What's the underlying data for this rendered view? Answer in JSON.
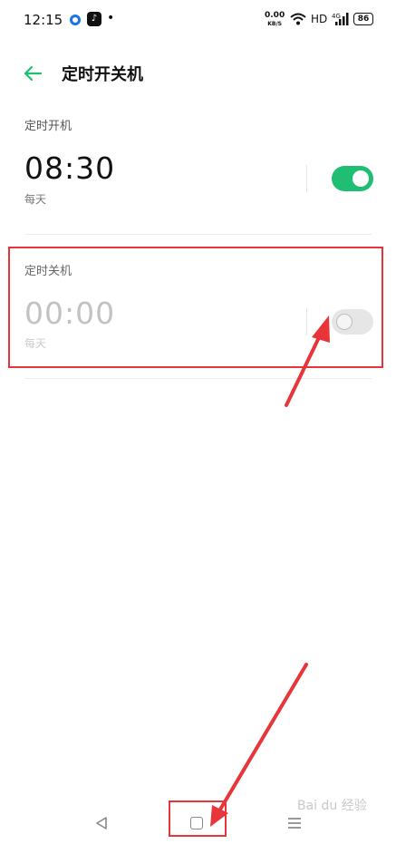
{
  "status_bar": {
    "time": "12:15",
    "speed_value": "0.00",
    "speed_unit": "KB/S",
    "network": "HD",
    "signal": "4G",
    "battery": "86"
  },
  "header": {
    "title": "定时开关机"
  },
  "power_on": {
    "section_label": "定时开机",
    "time": "08:30",
    "repeat": "每天",
    "enabled": true
  },
  "power_off": {
    "section_label": "定时关机",
    "time": "00:00",
    "repeat": "每天",
    "enabled": false
  },
  "watermark": "Bai du 经验",
  "colors": {
    "accent": "#1fbe72",
    "annotation": "#e8353a"
  }
}
